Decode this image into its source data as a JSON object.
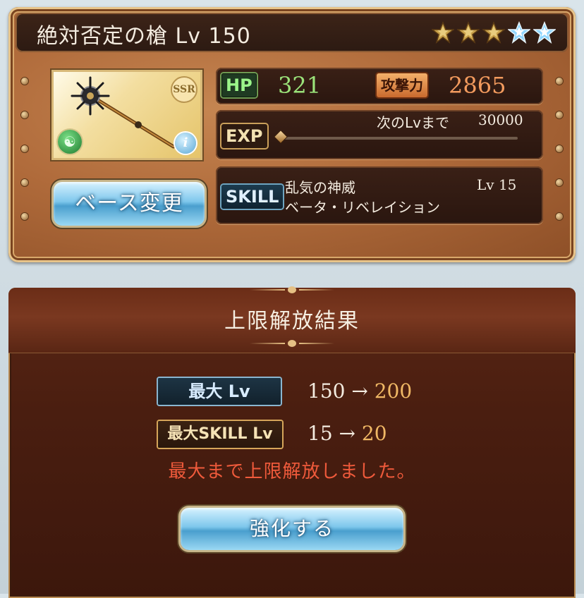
{
  "weapon": {
    "name_level": "絶対否定の槍 Lv 150",
    "rarity": "SSR",
    "uncap_stars": [
      {
        "type": "gold",
        "filled": true
      },
      {
        "type": "gold",
        "filled": true
      },
      {
        "type": "gold",
        "filled": true
      },
      {
        "type": "blue",
        "filled": true
      },
      {
        "type": "blue",
        "filled": true
      }
    ],
    "element_icon": "wind-element-icon",
    "info_icon": "info-icon",
    "info_glyph": "i"
  },
  "stats": {
    "hp_label": "HP",
    "hp_value": "321",
    "atk_label": "攻撃力",
    "atk_value": "2865",
    "exp_label": "EXP",
    "next_lv_text": "次のLvまで",
    "next_lv_value": "30000",
    "exp_progress": 0.0
  },
  "skill": {
    "label": "SKILL",
    "name": "乱気の神威",
    "level": "Lv 15",
    "description": "ベータ・リベレイション"
  },
  "buttons": {
    "base_change": "ベース変更",
    "enhance": "強化する"
  },
  "result": {
    "title": "上限解放結果",
    "max_lv_label": "最大 Lv",
    "max_lv_from": "150",
    "max_lv_to": "200",
    "max_skill_label": "最大SKILL Lv",
    "max_skill_from": "15",
    "max_skill_to": "20",
    "arrow": "→",
    "message": "最大まで上限解放しました。"
  },
  "colors": {
    "hp_value": "#9be37a",
    "atk_value": "#f39b5e",
    "upgraded_value": "#f0b865",
    "message": "#ef5a3b"
  }
}
